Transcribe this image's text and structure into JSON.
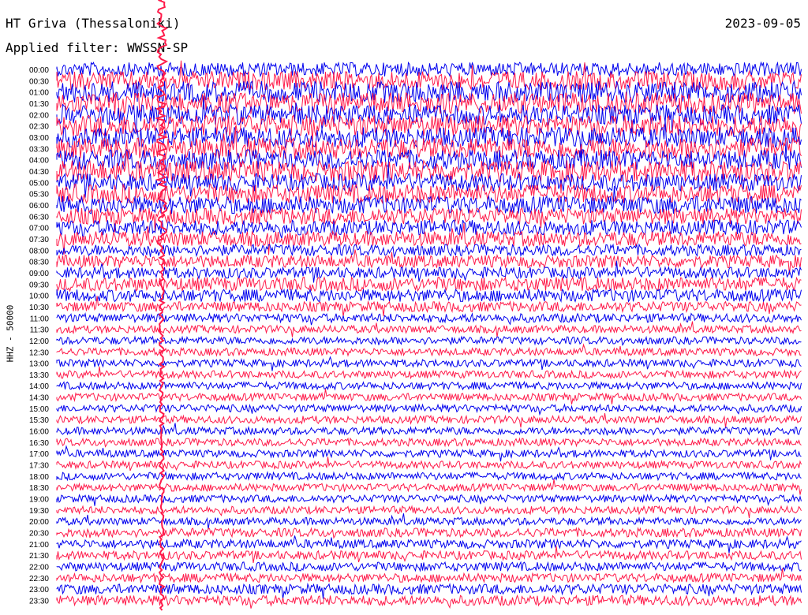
{
  "header": {
    "station": "HT Griva (Thessaloniki)",
    "date": "2023-09-05",
    "filter": "Applied filter: WWSSN-SP"
  },
  "axis": {
    "ylabel": "HHZ - 50000"
  },
  "colors": {
    "blue": "#0000ee",
    "red": "#ff1a4a"
  },
  "chart_data": {
    "type": "line",
    "title": "HT Griva (Thessaloniki)",
    "subtitle": "Applied filter: WWSSN-SP",
    "ylabel": "HHZ - 50000",
    "time_labels": [
      "00:00",
      "00:30",
      "01:00",
      "01:30",
      "02:00",
      "02:30",
      "03:00",
      "03:30",
      "04:00",
      "04:30",
      "05:00",
      "05:30",
      "06:00",
      "06:30",
      "07:00",
      "07:30",
      "08:00",
      "08:30",
      "09:00",
      "09:30",
      "10:00",
      "10:30",
      "11:00",
      "11:30",
      "12:00",
      "12:30",
      "13:00",
      "13:30",
      "14:00",
      "14:30",
      "15:00",
      "15:30",
      "16:00",
      "16:30",
      "17:00",
      "17:30",
      "18:00",
      "18:30",
      "19:00",
      "19:30",
      "20:00",
      "20:30",
      "21:00",
      "21:30",
      "22:00",
      "22:30",
      "23:00",
      "23:30"
    ],
    "trace_colors": [
      "blue",
      "red"
    ],
    "amplitude_profile": [
      0.55,
      0.75,
      0.85,
      0.85,
      0.8,
      0.85,
      0.8,
      0.85,
      0.8,
      0.85,
      0.7,
      0.75,
      0.7,
      0.65,
      0.6,
      0.6,
      0.45,
      0.5,
      0.45,
      0.55,
      0.5,
      0.4,
      0.35,
      0.3,
      0.3,
      0.3,
      0.3,
      0.3,
      0.3,
      0.3,
      0.3,
      0.3,
      0.3,
      0.3,
      0.3,
      0.3,
      0.3,
      0.3,
      0.3,
      0.3,
      0.3,
      0.35,
      0.35,
      0.35,
      0.35,
      0.35,
      0.4,
      0.4
    ]
  }
}
